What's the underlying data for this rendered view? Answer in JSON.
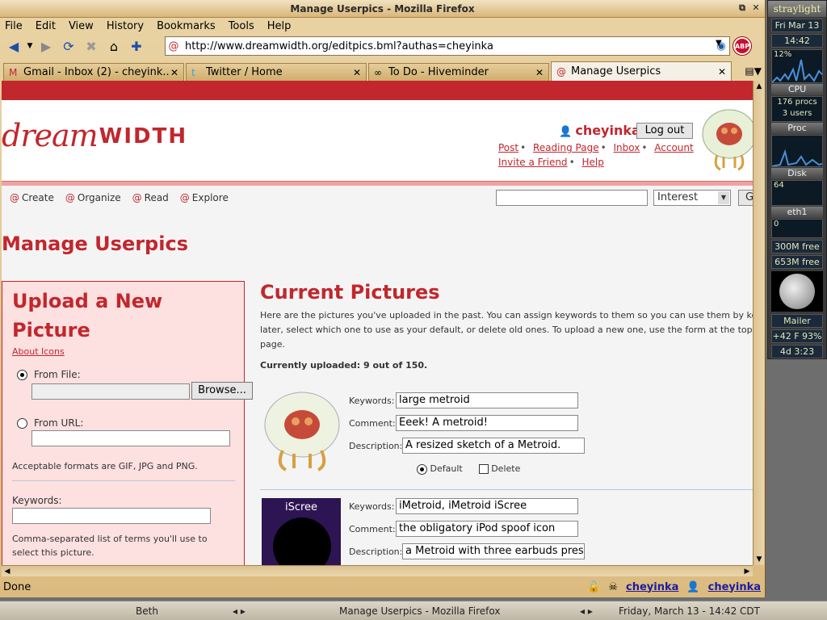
{
  "window": {
    "title": "Manage Userpics - Mozilla Firefox"
  },
  "menu": [
    "File",
    "Edit",
    "View",
    "History",
    "Bookmarks",
    "Tools",
    "Help"
  ],
  "url": "http://www.dreamwidth.org/editpics.bml?authas=cheyinka",
  "tabs": [
    {
      "label": "Gmail - Inbox (2) - cheyink...",
      "icon": "gmail-icon"
    },
    {
      "label": "Twitter / Home",
      "icon": "twitter-icon"
    },
    {
      "label": "To Do - Hiveminder",
      "icon": "hiveminder-icon"
    },
    {
      "label": "Manage Userpics",
      "icon": "dreamwidth-icon"
    }
  ],
  "site": {
    "logo_dream": "dream",
    "logo_width": "WIDTH",
    "username": "cheyinka",
    "logout": "Log out",
    "links_row1": [
      "Post",
      "Reading Page",
      "Inbox",
      "Account"
    ],
    "links_row2": [
      "Invite a Friend",
      "Help"
    ],
    "nav": [
      "Create",
      "Organize",
      "Read",
      "Explore"
    ],
    "search_select": "Interest",
    "search_go": "G"
  },
  "page": {
    "title": "Manage Userpics",
    "upload": {
      "heading": "Upload a New Picture",
      "about": "About Icons",
      "from_file": "From File:",
      "browse": "Browse...",
      "from_url": "From URL:",
      "formats": "Acceptable formats are GIF, JPG and PNG.",
      "keywords_label": "Keywords:",
      "keywords_help": "Comma-separated list of terms you'll use to select this picture."
    },
    "current": {
      "heading": "Current Pictures",
      "intro_1": "Here are the pictures you've uploaded in the past. You can assign keywords to them so you can use them by keyw",
      "intro_2": "later, select which one to use as your default, or delete old ones. To upload a new one, use the form at the top of t",
      "intro_3": "page.",
      "count": "Currently uploaded: 9 out of 150.",
      "labels": {
        "keywords": "Keywords:",
        "comment": "Comment:",
        "description": "Description:",
        "default": "Default",
        "delete": "Delete"
      },
      "pics": [
        {
          "keywords": "large metroid",
          "comment": "Eeek! A metroid!",
          "description": "A resized sketch of a Metroid."
        },
        {
          "keywords": "iMetroid, iMetroid iScree",
          "comment": "the obligatory iPod spoof icon",
          "description": "a Metroid with three earbuds press",
          "img_text": "iScree"
        }
      ]
    }
  },
  "status": {
    "text": "Done",
    "user1": "cheyinka",
    "user2": "cheyinka"
  },
  "gkrellm": {
    "host": "straylight",
    "date": "Fri Mar 13",
    "time": "14:42",
    "cpu_pct": "12%",
    "cpu_label": "CPU",
    "procs": "176 procs",
    "users": "3 users",
    "proc_label": "Proc",
    "disk_label": "Disk",
    "disk_val": "64",
    "net_label": "eth1",
    "net_val": "0",
    "mem1": "300M free",
    "mem2": "653M free",
    "mail_label": "Mailer",
    "temp": "+42 F 93%",
    "uptime": "4d  3:23"
  },
  "taskbar": {
    "item1": "Beth",
    "item2": "Manage Userpics - Mozilla Firefox",
    "clock": "Friday, March 13 - 14:42 CDT"
  }
}
